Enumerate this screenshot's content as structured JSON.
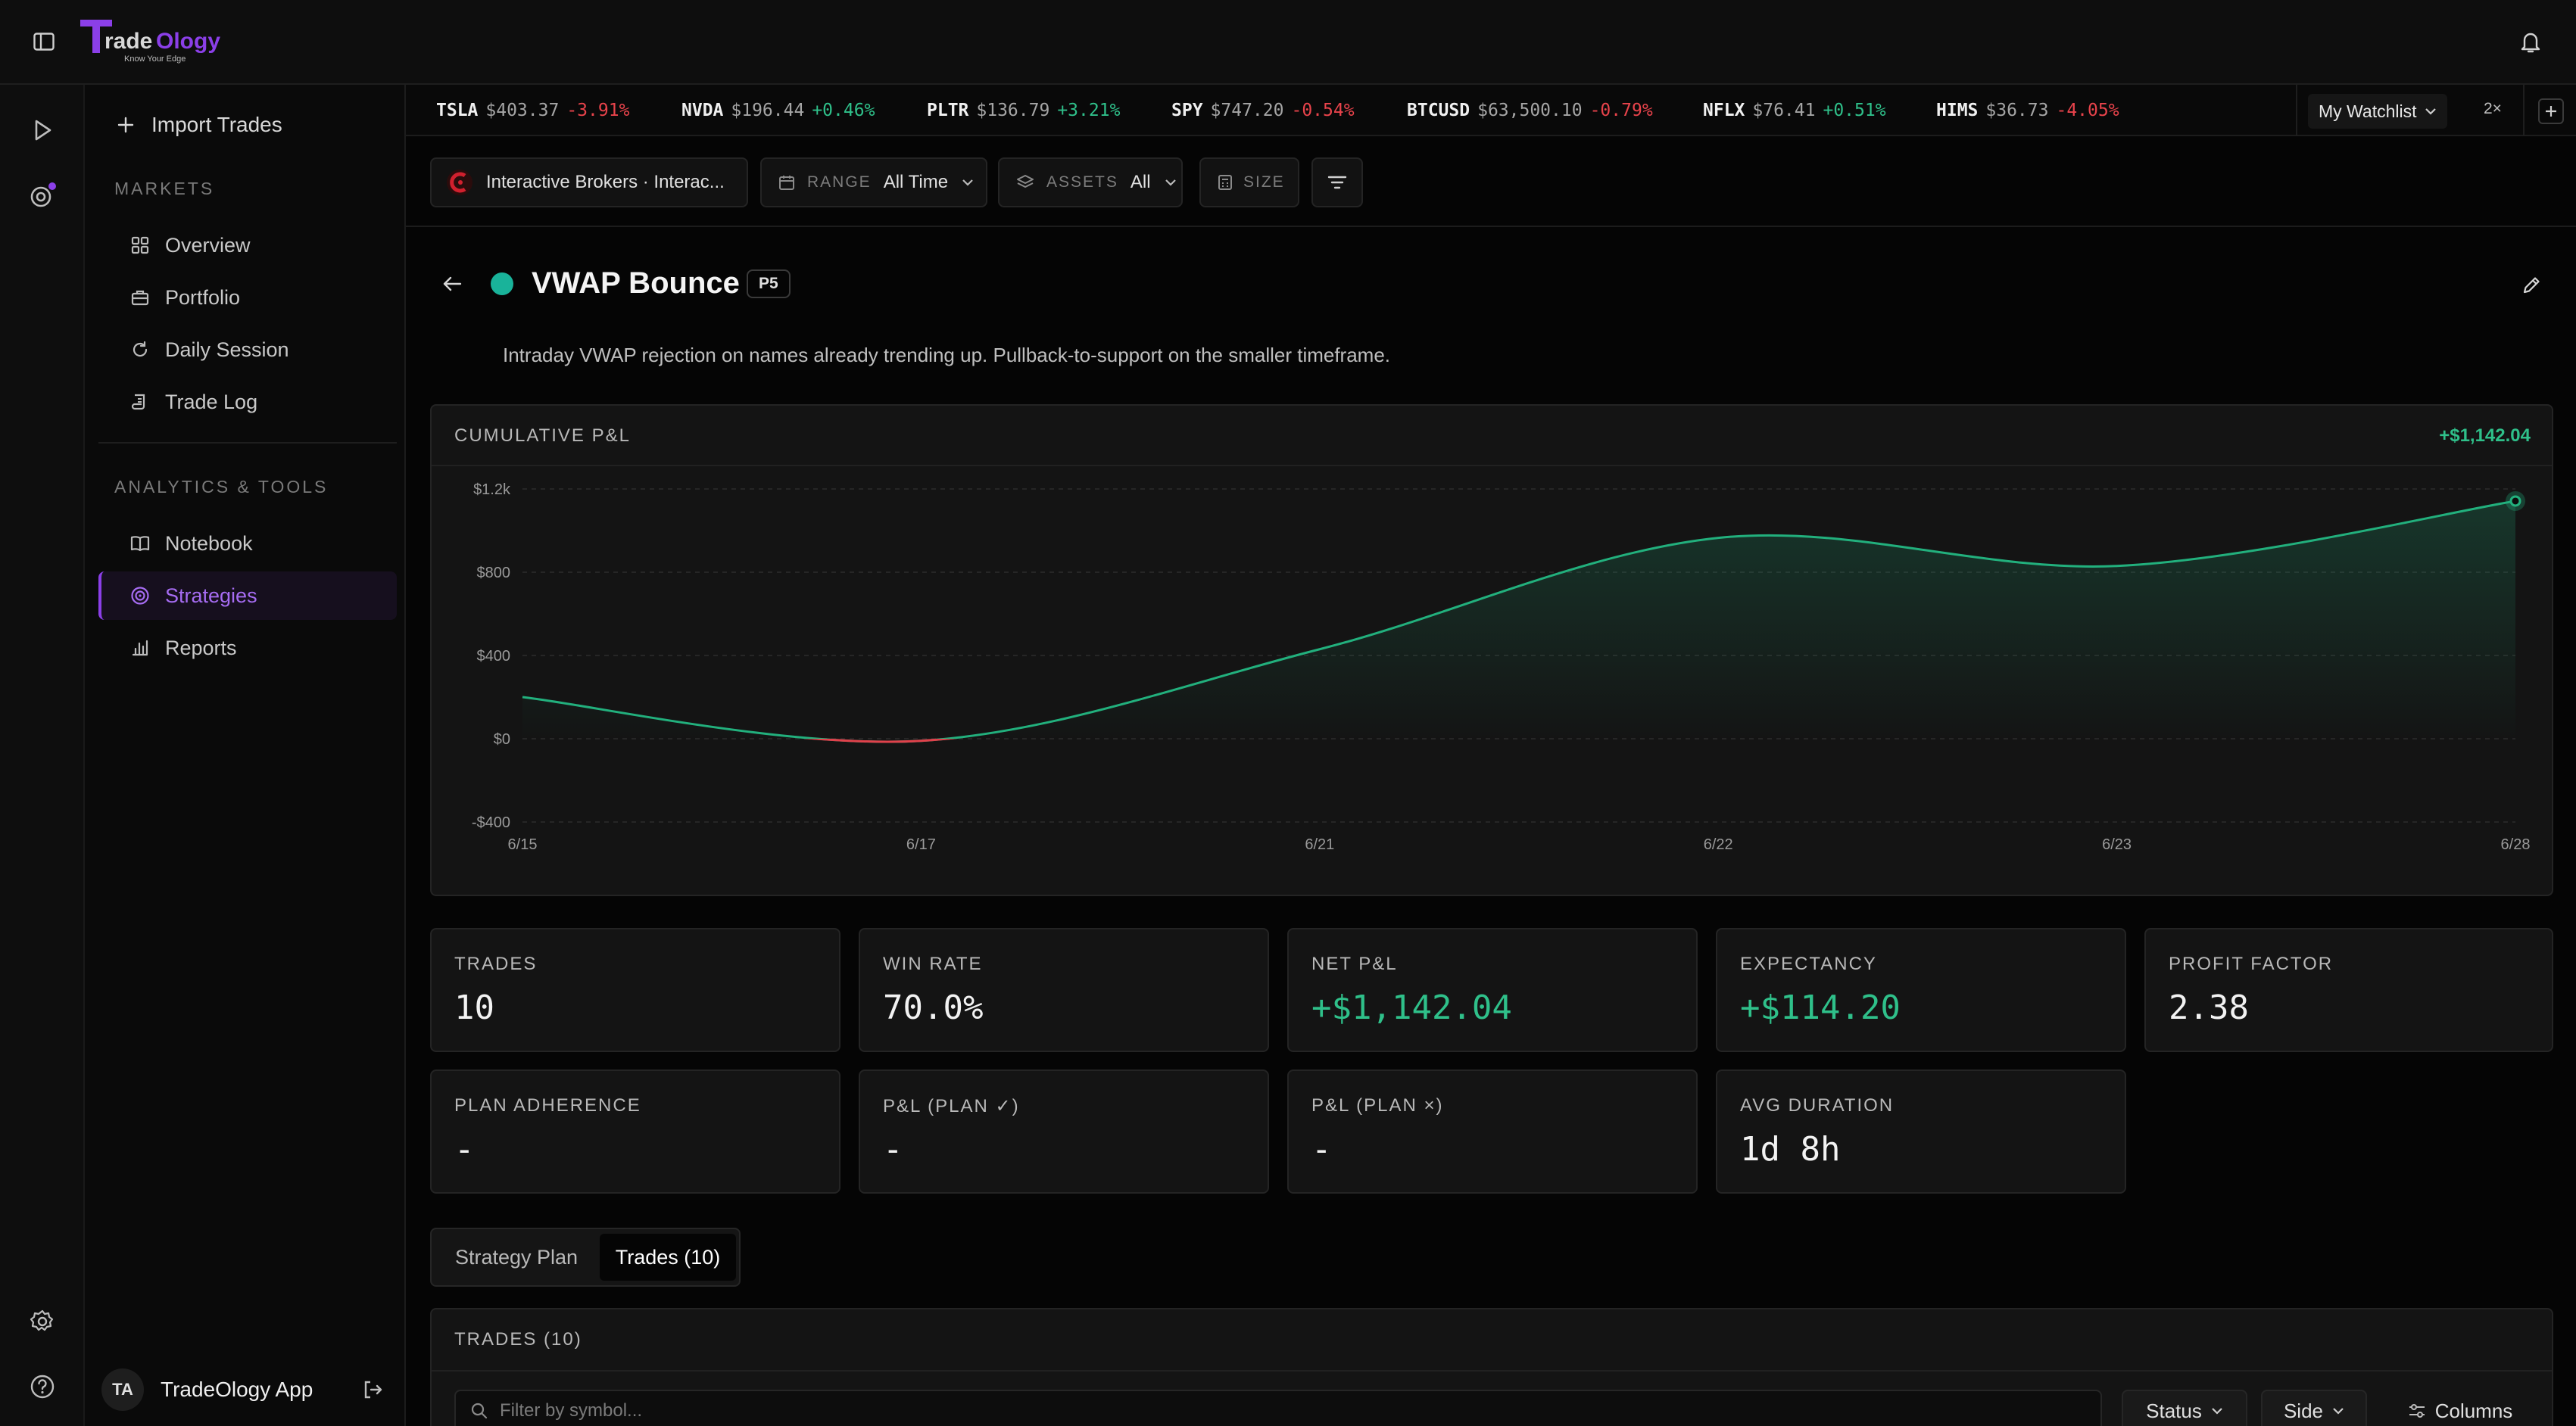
{
  "app": {
    "logo_name": "TradeOlogy",
    "logo_tagline": "Know Your Edge"
  },
  "sidebar": {
    "import_label": "Import Trades",
    "markets_heading": "MARKETS",
    "analytics_heading": "ANALYTICS & TOOLS",
    "items": [
      {
        "label": "Overview",
        "icon": "grid-icon"
      },
      {
        "label": "Portfolio",
        "icon": "briefcase-icon"
      },
      {
        "label": "Daily Session",
        "icon": "cycle-icon"
      },
      {
        "label": "Trade Log",
        "icon": "scroll-icon"
      },
      {
        "label": "Notebook",
        "icon": "book-icon"
      },
      {
        "label": "Strategies",
        "icon": "target-icon",
        "active": true
      },
      {
        "label": "Reports",
        "icon": "bar-chart-icon"
      }
    ],
    "user": {
      "initials": "TA",
      "name": "TradeOlogy App"
    }
  },
  "ticker": [
    {
      "symbol": "TSLA",
      "price": "$403.37",
      "change": "-3.91%",
      "dir": "down"
    },
    {
      "symbol": "NVDA",
      "price": "$196.44",
      "change": "+0.46%",
      "dir": "up"
    },
    {
      "symbol": "PLTR",
      "price": "$136.79",
      "change": "+3.21%",
      "dir": "up"
    },
    {
      "symbol": "SPY",
      "price": "$747.20",
      "change": "-0.54%",
      "dir": "down"
    },
    {
      "symbol": "BTCUSD",
      "price": "$63,500.10",
      "change": "-0.79%",
      "dir": "down"
    },
    {
      "symbol": "NFLX",
      "price": "$76.41",
      "change": "+0.51%",
      "dir": "up"
    },
    {
      "symbol": "HIMS",
      "price": "$36.73",
      "change": "-4.05%",
      "dir": "down"
    }
  ],
  "watchlist": {
    "label": "My Watchlist",
    "speed": "2×"
  },
  "filters": {
    "account": "Interactive Brokers · Interac...",
    "range_label": "RANGE",
    "range_value": "All Time",
    "assets_label": "ASSETS",
    "assets_value": "All",
    "size_label": "SIZE"
  },
  "strategy": {
    "name": "VWAP Bounce",
    "badge": "P5",
    "description": "Intraday VWAP rejection on names already trending up. Pullback-to-support on the smaller timeframe.",
    "color": "#19b39a"
  },
  "chart_card": {
    "title": "CUMULATIVE P&L",
    "total": "+$1,142.04"
  },
  "chart_data": {
    "type": "area",
    "title": "CUMULATIVE P&L",
    "xlabel": "",
    "ylabel": "",
    "x": [
      "6/15",
      "6/17",
      "6/21",
      "6/22",
      "6/23",
      "6/28"
    ],
    "y": [
      200,
      -10,
      430,
      965,
      830,
      1142.04
    ],
    "yticks": [
      "$1.2k",
      "$800",
      "$400",
      "$0",
      "-$400"
    ],
    "ytick_values": [
      1200,
      800,
      400,
      0,
      -400
    ],
    "ylim": [
      -400,
      1200
    ],
    "grid": true,
    "positive_color": "#22b07d",
    "negative_color": "#e0414b"
  },
  "stats": [
    {
      "label": "TRADES",
      "value": "10",
      "tone": "neutral"
    },
    {
      "label": "WIN RATE",
      "value": "70.0%",
      "tone": "neutral"
    },
    {
      "label": "NET P&L",
      "value": "+$1,142.04",
      "tone": "up"
    },
    {
      "label": "EXPECTANCY",
      "value": "+$114.20",
      "tone": "up"
    },
    {
      "label": "PROFIT FACTOR",
      "value": "2.38",
      "tone": "neutral"
    },
    {
      "label": "PLAN ADHERENCE",
      "value": "-",
      "tone": "neutral"
    },
    {
      "label": "P&L (PLAN ✓)",
      "value": "-",
      "tone": "neutral"
    },
    {
      "label": "P&L (PLAN ×)",
      "value": "-",
      "tone": "neutral"
    },
    {
      "label": "AVG DURATION",
      "value": "1d 8h",
      "tone": "neutral"
    }
  ],
  "tabs": {
    "plan": "Strategy Plan",
    "trades": "Trades (10)"
  },
  "trades_panel": {
    "title": "TRADES (10)",
    "filter_placeholder": "Filter by symbol...",
    "status_label": "Status",
    "side_label": "Side",
    "columns_label": "Columns"
  }
}
